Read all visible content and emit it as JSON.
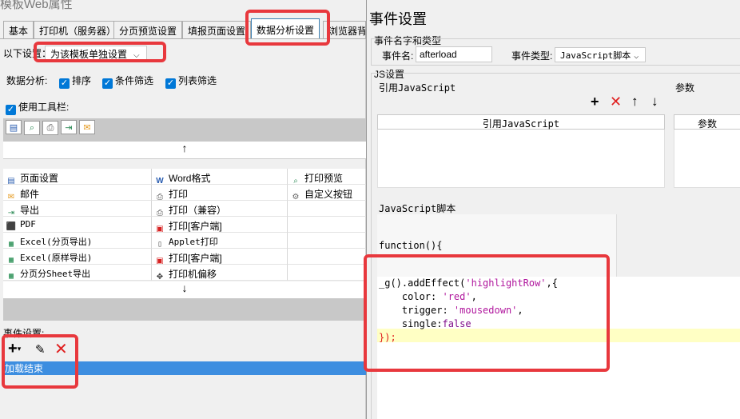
{
  "window": {
    "title": "模板Web属性"
  },
  "tabs": [
    "基本",
    "打印机（服务器）",
    "分页预览设置",
    "填报页面设置",
    "数据分析设置",
    "浏览器背"
  ],
  "active_tab": "数据分析设置",
  "settings": {
    "scope_label": "以下设置：",
    "scope_value": "为该模板单独设置",
    "analysis_label": "数据分析:",
    "options": [
      "排序",
      "条件筛选",
      "列表筛选"
    ],
    "toolbar_checkbox": "使用工具栏:"
  },
  "toolbar_items": [
    [
      "页面设置",
      "Word格式",
      "打印预览"
    ],
    [
      "邮件",
      "打印",
      "自定义按钮"
    ],
    [
      "导出",
      "打印（兼容）",
      ""
    ],
    [
      "PDF",
      "打印[客户端]",
      ""
    ],
    [
      "Excel(分页导出)",
      "Applet打印",
      ""
    ],
    [
      "Excel(原样导出)",
      "打印[客户端]",
      ""
    ],
    [
      "分页分Sheet导出",
      "打印机偏移",
      ""
    ]
  ],
  "arrows": {
    "up": "↑",
    "down": "↓"
  },
  "events": {
    "label": "事件设置:",
    "add": "+",
    "items": [
      "加载结束"
    ]
  },
  "dialog": {
    "title": "事件设置",
    "name_group": "事件名字和类型",
    "event_name_label": "事件名:",
    "event_name_value": "afterload",
    "event_type_label": "事件类型:",
    "event_type_value": "JavaScript脚本",
    "js_group": "JS设置",
    "ref_js_label": "引用JavaScript",
    "params_label": "参数",
    "ref_js_column": "引用JavaScript",
    "params_column": "参数",
    "script_label": "JavaScript脚本",
    "function_header": "function(){",
    "code": {
      "l1_a": "_g().addEffect(",
      "l1_b": "'highlightRow'",
      "l1_c": ",{",
      "l2_a": "    color: ",
      "l2_b": "'red'",
      "l2_c": ",",
      "l3_a": "    trigger: ",
      "l3_b": "'mousedown'",
      "l3_c": ",",
      "l4_a": "    single:",
      "l4_b": "false",
      "l5": "});"
    }
  },
  "colors": {
    "accent": "#0078d7",
    "highlight_box": "#e8383d",
    "selected_row": "#3d8ee0",
    "code_highlight": "#ffffc4"
  }
}
